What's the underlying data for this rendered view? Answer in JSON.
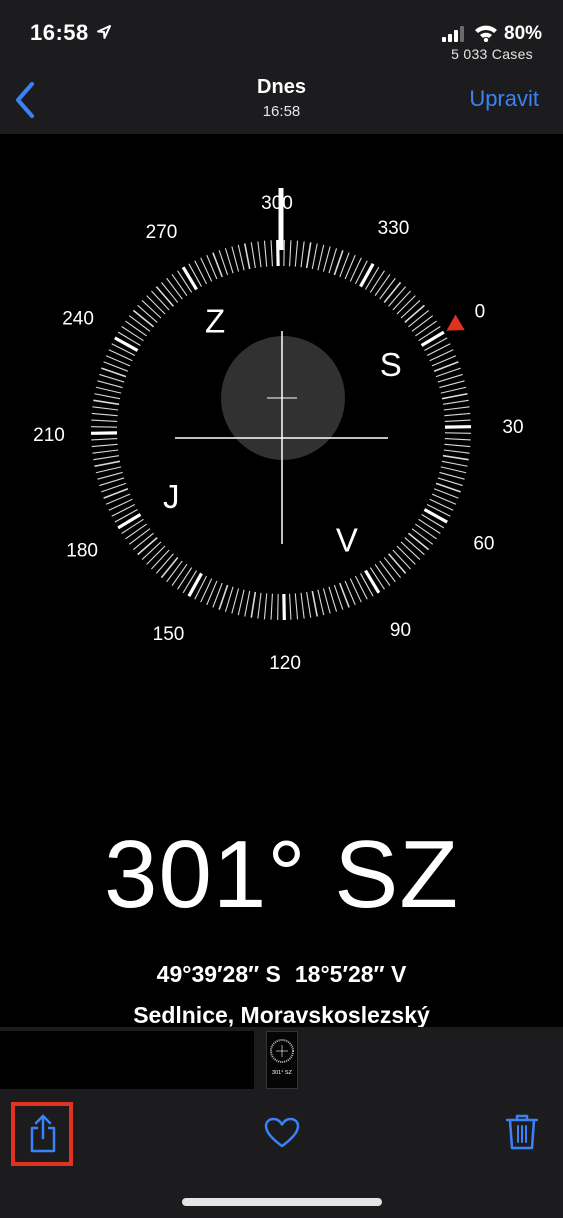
{
  "status_bar": {
    "time": "16:58",
    "battery": "80%",
    "carrier_label": "5 033 Cases"
  },
  "nav": {
    "title": "Dnes",
    "subtitle": "16:58",
    "edit_label": "Upravit"
  },
  "compass": {
    "degree_labels": [
      "300",
      "330",
      "0",
      "30",
      "60",
      "90",
      "120",
      "150",
      "180",
      "210",
      "240",
      "270"
    ],
    "cardinal_labels": [
      "Z",
      "S",
      "V",
      "J"
    ],
    "heading_deg": 301,
    "colors": {
      "north_marker": "#e0331f",
      "ticks": "#ffffff",
      "dial_bg": "#000000"
    }
  },
  "reading": {
    "heading": "301° SZ",
    "latitude": "49°39′28″ S",
    "longitude": "18°5′28″ V",
    "place": "Sedlnice, Moravskoslezský"
  },
  "thumbnail": {
    "caption": "301° SZ"
  },
  "toolbar": {
    "share_icon": "share-icon",
    "favorite_icon": "heart-icon",
    "delete_icon": "trash-icon",
    "accent": "#3a82f7",
    "highlight": "#e0331f"
  }
}
